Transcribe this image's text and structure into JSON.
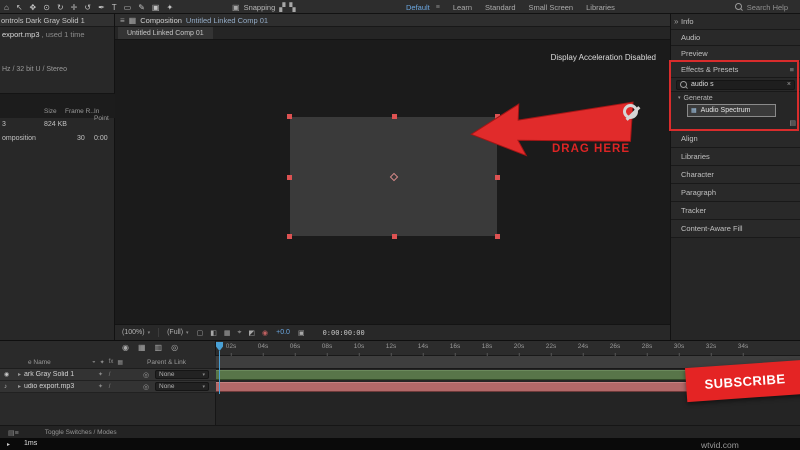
{
  "colors": {
    "accent_red": "#dd2c2c",
    "accent_blue": "#6ba7e0",
    "layer_bar_green": "#587549",
    "layer_bar_red": "#b26868"
  },
  "icons": {
    "menu": "≡",
    "chevrons": "»",
    "caret_down": "▾",
    "close": "×",
    "twirl_open": "▾",
    "twirl_row": "▸",
    "eye": "◉",
    "speaker": "♪",
    "pickwhip": "◎",
    "camera": "▣",
    "comp": "▦",
    "effect": "▦",
    "badge": "▤"
  },
  "topbar": {
    "tools": [
      {
        "name": "home-icon",
        "glyph": "⌂"
      },
      {
        "name": "selection-tool-icon",
        "glyph": "↖"
      },
      {
        "name": "hand-tool-icon",
        "glyph": "✥"
      },
      {
        "name": "zoom-tool-icon",
        "glyph": "⊙"
      },
      {
        "name": "orbit-tool-icon",
        "glyph": "↻"
      },
      {
        "name": "pan-tool-icon",
        "glyph": "✛"
      },
      {
        "name": "rotation-tool-icon",
        "glyph": "↺"
      },
      {
        "name": "pen-tool-icon",
        "glyph": "✒"
      },
      {
        "name": "type-tool-icon",
        "glyph": "T"
      },
      {
        "name": "rectangle-tool-icon",
        "glyph": "▭"
      },
      {
        "name": "brush-tool-icon",
        "glyph": "✎"
      },
      {
        "name": "clone-stamp-tool-icon",
        "glyph": "▣"
      },
      {
        "name": "puppet-tool-icon",
        "glyph": "✦"
      }
    ],
    "snap_checkbox_glyph": "▣",
    "snapping_label": "Snapping",
    "snap_opt1_glyph": "▞",
    "snap_opt2_glyph": "▚",
    "workspaces": [
      "Default",
      "Learn",
      "Standard",
      "Small Screen",
      "Libraries"
    ],
    "search_help": "Search Help"
  },
  "left_panel": {
    "header": "ontrols Dark Gray Solid 1",
    "file_name": "export.mp3",
    "file_note": ", used 1 time",
    "file_info": "Hz / 32 bit U / Stereo",
    "col_size": "Size",
    "col_frame_rate": "Frame R...",
    "col_in_point": "In Point",
    "row1_label": "3",
    "row1_size": "824 KB",
    "row2_label": "omposition",
    "row2_frame_rate": "30",
    "row2_in_point": "0:00"
  },
  "comp_panel": {
    "panel_title": "Composition",
    "comp_name": "Untitled Linked Comp 01",
    "tab_label": "Untitled Linked Comp 01",
    "notice": "Display Acceleration Disabled",
    "drag_label": "DRAG HERE",
    "zoom_level": "(100%)",
    "resolution": "(Full)",
    "exposure": "+0.0",
    "timecode": "0:00:00:00",
    "viewer_icons": [
      {
        "name": "region-of-interest-icon",
        "glyph": "▢"
      },
      {
        "name": "transparency-grid-icon",
        "glyph": "◧"
      },
      {
        "name": "grid-guides-icon",
        "glyph": "▦"
      },
      {
        "name": "current-view-icon",
        "glyph": "⌖"
      },
      {
        "name": "mask-visibility-icon",
        "glyph": "◩"
      },
      {
        "name": "channels-icon",
        "glyph": "◉"
      }
    ]
  },
  "right_panel": {
    "collapsed_above": [
      "Info",
      "Audio",
      "Preview"
    ],
    "effects_title": "Effects & Presets",
    "search_value": "audio s",
    "group_label": "Generate",
    "result_label": "Audio Spectrum",
    "collapsed_below": [
      "Align",
      "Libraries",
      "Character",
      "Paragraph",
      "Tracker",
      "Content-Aware Fill"
    ]
  },
  "timeline": {
    "ruler_ticks": [
      "02s",
      "04s",
      "06s",
      "08s",
      "10s",
      "12s",
      "14s",
      "16s",
      "18s",
      "20s",
      "22s",
      "24s",
      "26s",
      "28s",
      "30s",
      "32s",
      "34s"
    ],
    "view_icons": [
      {
        "name": "comp-mini-flowchart-icon",
        "glyph": "◉"
      },
      {
        "name": "draft-3d-icon",
        "glyph": "▦"
      },
      {
        "name": "frame-blend-icon",
        "glyph": "▥"
      },
      {
        "name": "motion-blur-icon",
        "glyph": "◎"
      }
    ],
    "name_header": "e Name",
    "column_icons": [
      {
        "name": "video-audio-column-icon",
        "glyph": "◒"
      },
      {
        "name": "solo-column-icon",
        "glyph": "✦"
      },
      {
        "name": "fx-column-icon",
        "glyph": "fx"
      },
      {
        "name": "quality-column-icon",
        "glyph": "▦"
      }
    ],
    "parent_header": "Parent & Link",
    "row_switches": "✦ /",
    "layers": [
      {
        "name": "ark Gray Solid 1",
        "parent": "None"
      },
      {
        "name": "udio export.mp3",
        "parent": "None"
      }
    ],
    "bottom_icons": [
      {
        "name": "expand-layers-icon",
        "glyph": "▤"
      },
      {
        "name": "collapse-layers-icon",
        "glyph": "≡"
      }
    ],
    "toggle_label": "Toggle Switches / Modes",
    "perf_label": "1ms"
  },
  "overlay": {
    "subscribe_label": "SUBSCRIBE",
    "watermark": "wtvid.com"
  }
}
